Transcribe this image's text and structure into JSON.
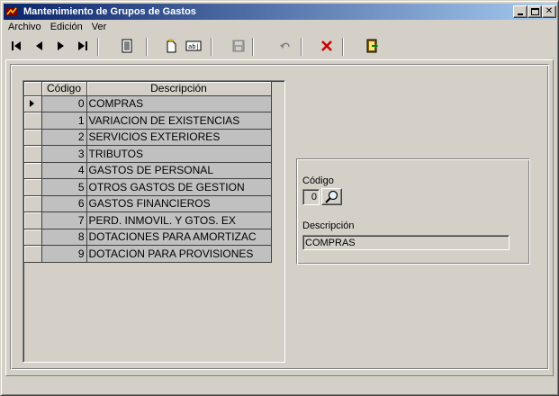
{
  "window": {
    "title": "Mantenimiento de Grupos de Gastos"
  },
  "menu": [
    {
      "label": "Archivo"
    },
    {
      "label": "Edición"
    },
    {
      "label": "Ver"
    }
  ],
  "grid": {
    "columns": [
      "Código",
      "Descripción"
    ],
    "rows": [
      {
        "codigo": "0",
        "descripcion": "COMPRAS"
      },
      {
        "codigo": "1",
        "descripcion": "VARIACION DE EXISTENCIAS"
      },
      {
        "codigo": "2",
        "descripcion": "SERVICIOS EXTERIORES"
      },
      {
        "codigo": "3",
        "descripcion": "TRIBUTOS"
      },
      {
        "codigo": "4",
        "descripcion": "GASTOS DE PERSONAL"
      },
      {
        "codigo": "5",
        "descripcion": "OTROS GASTOS DE GESTION"
      },
      {
        "codigo": "6",
        "descripcion": "GASTOS FINANCIEROS"
      },
      {
        "codigo": "7",
        "descripcion": "PERD. INMOVIL. Y GTOS. EX"
      },
      {
        "codigo": "8",
        "descripcion": "DOTACIONES PARA AMORTIZAC"
      },
      {
        "codigo": "9",
        "descripcion": "DOTACION PARA PROVISIONES"
      }
    ]
  },
  "detail": {
    "codigo_label": "Código",
    "codigo_value": "0",
    "descripcion_label": "Descripción",
    "descripcion_value": "COMPRAS"
  },
  "toolbar": {
    "icons": [
      "first-record-icon",
      "prev-record-icon",
      "next-record-icon",
      "last-record-icon",
      "list-icon",
      "new-record-icon",
      "edit-record-icon",
      "save-icon",
      "undo-icon",
      "delete-icon",
      "exit-icon"
    ]
  },
  "colors": {
    "title_start": "#0a246a",
    "title_end": "#a6caf0",
    "delete_red": "#cc0000"
  }
}
